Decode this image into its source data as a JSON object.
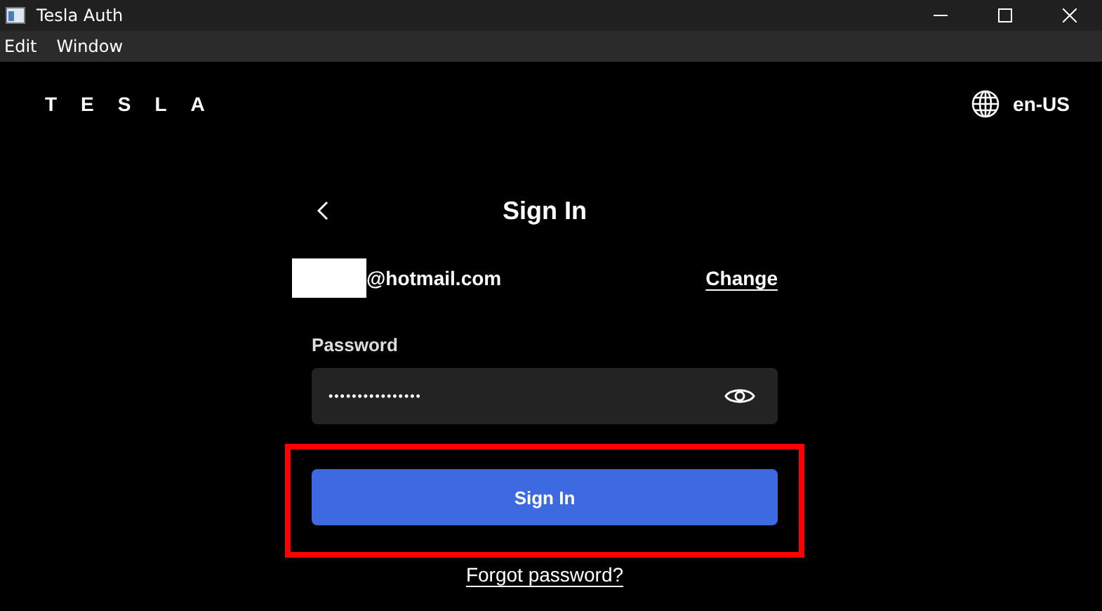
{
  "window": {
    "title": "Tesla Auth"
  },
  "menu": [
    "Edit",
    "Window"
  ],
  "header": {
    "logo": "TESLA",
    "language": "en-US"
  },
  "form": {
    "title": "Sign In",
    "email_suffix": "@hotmail.com",
    "email_redacted": true,
    "change_link": "Change",
    "password_label": "Password",
    "password_value": "••••••••••••••••",
    "submit": "Sign In",
    "submit_highlighted": true,
    "forgot_link": "Forgot password?"
  }
}
